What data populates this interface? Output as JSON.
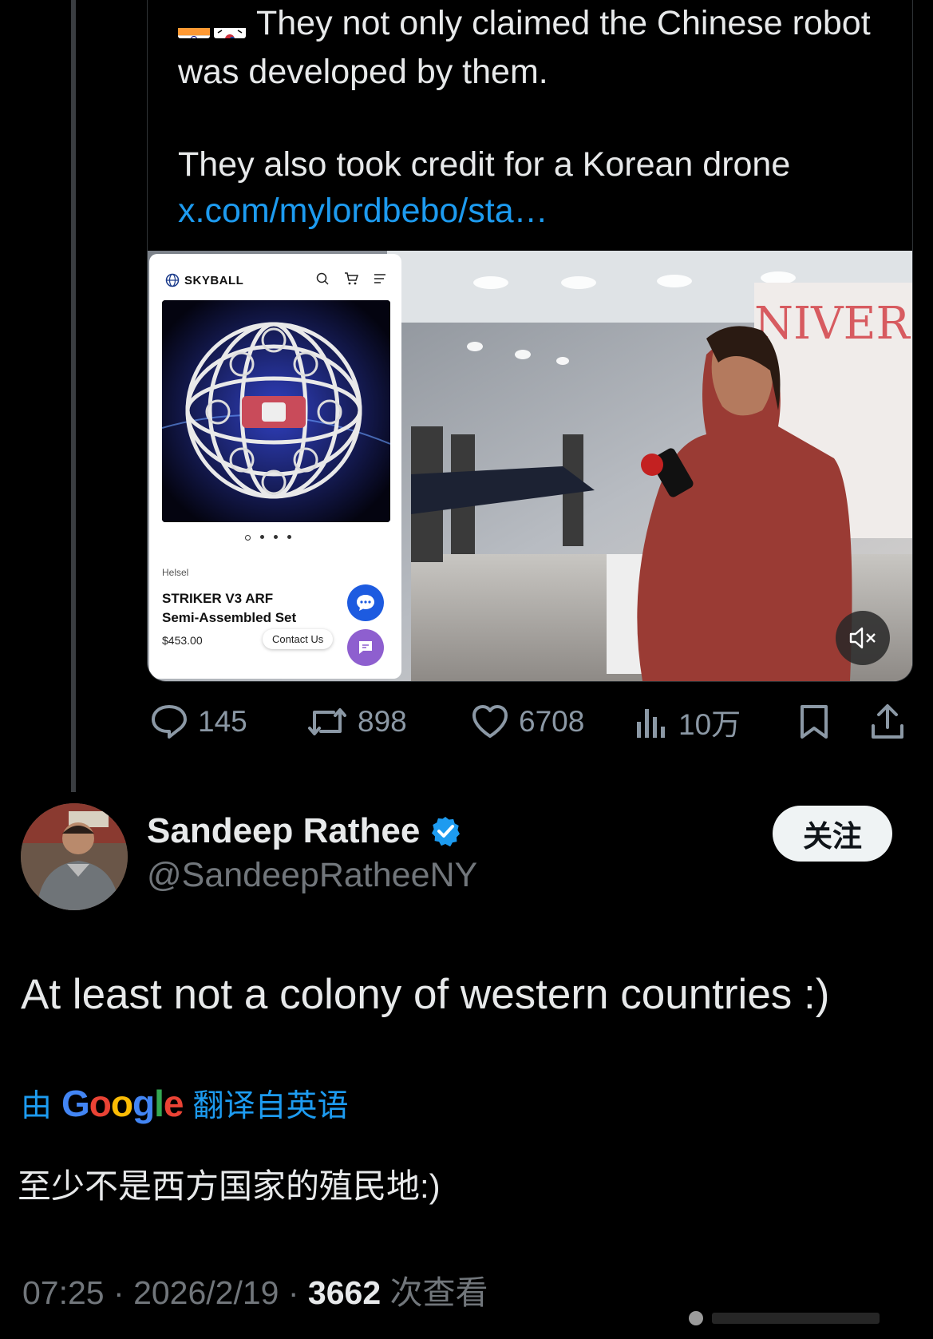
{
  "quoted_tweet": {
    "flag_icons": [
      "india-flag",
      "south-korea-flag"
    ],
    "line1": "They not only claimed the Chinese robot was developed by them.",
    "line2": "They also took credit for a Korean drone",
    "link_text": "x.com/mylordbebo/sta…"
  },
  "media": {
    "site_brand": "SKYBALL",
    "product_brand": "Helsel",
    "product_name_line1": "STRIKER V3 ARF",
    "product_name_line2": "Semi-Assembled Set",
    "product_price": "$453.00",
    "contact_label": "Contact Us",
    "background_watermark": "NIVERSI"
  },
  "actions": {
    "replies": "145",
    "reposts": "898",
    "likes": "6708",
    "views": "10万"
  },
  "reply": {
    "author_name": "Sandeep Rathee",
    "author_handle": "@SandeepRatheeNY",
    "follow_label": "关注",
    "text": "At least not a colony of western countries :)",
    "translate_prefix": "由",
    "translate_brand": "Google",
    "translate_suffix": "翻译自英语",
    "translated_text": "至少不是西方国家的殖民地:)",
    "time": "07:25",
    "date": "2026/2/19",
    "views_count": "3662",
    "views_label": "次查看"
  },
  "colors": {
    "background": "#000000",
    "text": "#e7e9ea",
    "muted": "#71767b",
    "link": "#1d9bf0",
    "verified": "#1d9bf0",
    "follow_bg": "#eff3f4"
  }
}
